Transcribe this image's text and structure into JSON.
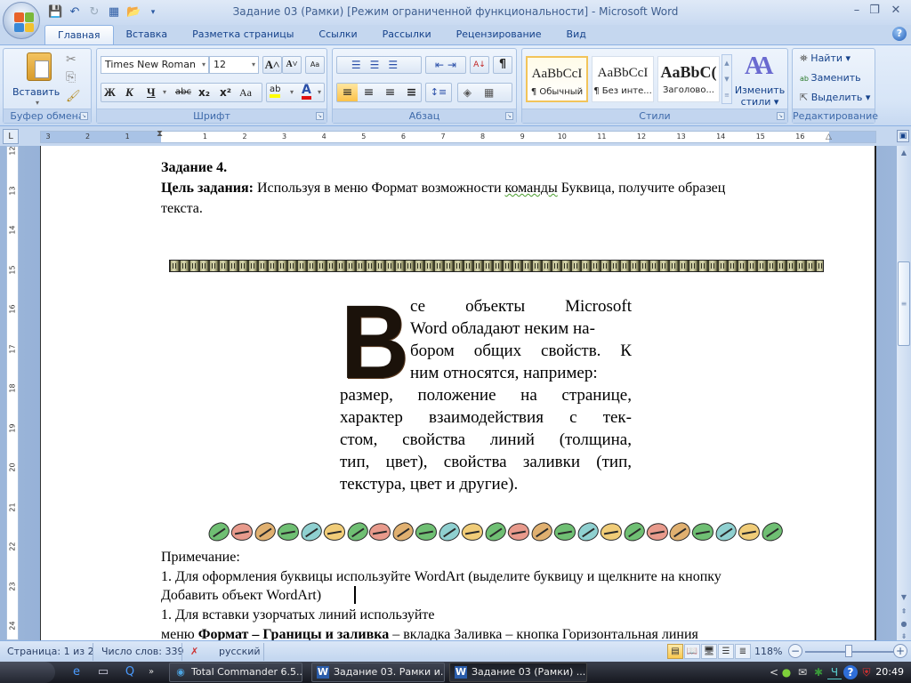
{
  "window": {
    "title": "Задание 03 (Рамки) [Режим ограниченной функциональности] - Microsoft Word",
    "minimize": "–",
    "restore": "❐",
    "close": "✕"
  },
  "quick_access": {
    "save_icon": "💾",
    "undo_icon": "↶",
    "redo_icon": "↻",
    "layout_icon": "▦",
    "open_icon": "📂",
    "customize_icon": "▾"
  },
  "tabs": [
    "Главная",
    "Вставка",
    "Разметка страницы",
    "Ссылки",
    "Рассылки",
    "Рецензирование",
    "Вид"
  ],
  "help": "?",
  "ribbon": {
    "clipboard": {
      "label": "Буфер обмена",
      "paste": "Вставить",
      "cut_icon": "✂",
      "copy_icon": "⎘",
      "format_painter_icon": "🖌"
    },
    "font": {
      "label": "Шрифт",
      "font_name": "Times New Roman",
      "font_size": "12",
      "grow": "A˄",
      "shrink": "A˅",
      "clear": "Aa",
      "bold": "Ж",
      "italic": "К",
      "underline": "Ч",
      "strike": "abc",
      "subscript": "x₂",
      "superscript": "x²",
      "case": "Aa",
      "highlight": "ab",
      "font_color": "A",
      "highlight_color": "#ffff00",
      "font_color_value": "#e01010"
    },
    "paragraph": {
      "label": "Абзац",
      "bullets": "☰",
      "numbering": "☰",
      "multilevel": "☰",
      "decrease_indent": "⇤",
      "increase_indent": "⇥",
      "sort": "A↓",
      "show_marks": "¶",
      "align_left": "≡",
      "center": "≡",
      "align_right": "≡",
      "justify": "≡",
      "line_spacing": "↕≡",
      "shading": "◈",
      "borders": "▦"
    },
    "styles": {
      "label": "Стили",
      "items": [
        {
          "sample": "AaBbCcI",
          "name": "¶ Обычный"
        },
        {
          "sample": "AaBbCcI",
          "name": "¶ Без инте..."
        },
        {
          "sample": "AaBbC(",
          "name": "Заголово..."
        }
      ],
      "change_styles": "Изменить стили",
      "change_styles_line1": "Изменить",
      "change_styles_line2": "стили ▾"
    },
    "editing": {
      "label": "Редактирование",
      "find": "Найти ▾",
      "replace": "Заменить",
      "select": "Выделить ▾"
    }
  },
  "ruler": {
    "tab_selector": "L",
    "h_ticks": [
      "3",
      "2",
      "1",
      "",
      "1",
      "2",
      "3",
      "4",
      "5",
      "6",
      "7",
      "8",
      "9",
      "10",
      "11",
      "12",
      "13",
      "14",
      "15",
      "16"
    ],
    "v_ticks": [
      "12",
      "13",
      "14",
      "15",
      "16",
      "17",
      "18",
      "19",
      "20",
      "21",
      "22",
      "23",
      "24"
    ]
  },
  "document": {
    "task_heading": "Задание 4.",
    "goal_label": "Цель задания:",
    "goal_text_1": " Используя в меню  Формат возможности ",
    "goal_text_squig": "команды",
    "goal_text_2": " Буквица, получите образец",
    "goal_text_3": "текста.",
    "drop_cap_letter": "В",
    "drop_cap_lines": [
      [
        "се",
        "объекты",
        "Microsoft"
      ],
      [
        "Word обладают неким на-"
      ],
      [
        "бором",
        "общих",
        "свойств.",
        "К"
      ],
      [
        "ним относятся, например:"
      ],
      [
        "размер,",
        "положение",
        "на",
        "странице,"
      ],
      [
        "характер",
        "взаимодействия",
        "с",
        "тек-"
      ],
      [
        "стом,",
        "свойства",
        "линий",
        "(толщина,"
      ],
      [
        "тип,",
        "цвет),",
        "свойства",
        "заливки",
        "(тип,"
      ],
      [
        "текстура, цвет и другие)."
      ]
    ],
    "note_heading": "Примечание:",
    "note_1a": "1. Для оформления буквицы используйте WordArt (выделите буквицу и щелкните на кнопку",
    "note_1b_squig": "Д",
    "note_1b": "обавить объект WordArt)",
    "note_2a": "1. Для вставки узорчатых линий используйте",
    "note_2b_1": "меню ",
    "note_2b_bold": "Формат – Границы и заливка",
    "note_2b_2": " – вкладка Заливка – кнопка Горизонтальная линия",
    "leaf_colors": [
      "#6fbf73",
      "#e89a8c",
      "#e0b070",
      "#6fbf73",
      "#8fd0d0",
      "#f0cc78"
    ]
  },
  "statusbar": {
    "page": "Страница: 1 из 2",
    "words": "Число слов: 339",
    "language": "русский",
    "zoom": "118%",
    "zoom_value_percent": 118,
    "views": [
      "▤",
      "📖",
      "🖥",
      "☰",
      "≣"
    ]
  },
  "taskbar": {
    "quick_launch": [
      "e",
      "▭",
      "Q",
      "»"
    ],
    "tasks": [
      {
        "label": "Total Commander 6.5...",
        "icon": "◉"
      },
      {
        "label": "Задание 03. Рамки и...",
        "icon": "W"
      },
      {
        "label": "Задание 03 (Рамки) ...",
        "icon": "W"
      }
    ],
    "tray": [
      "<",
      "●",
      "✉",
      "✱",
      "Ч",
      "?",
      "⛨"
    ],
    "clock": "20:49"
  }
}
